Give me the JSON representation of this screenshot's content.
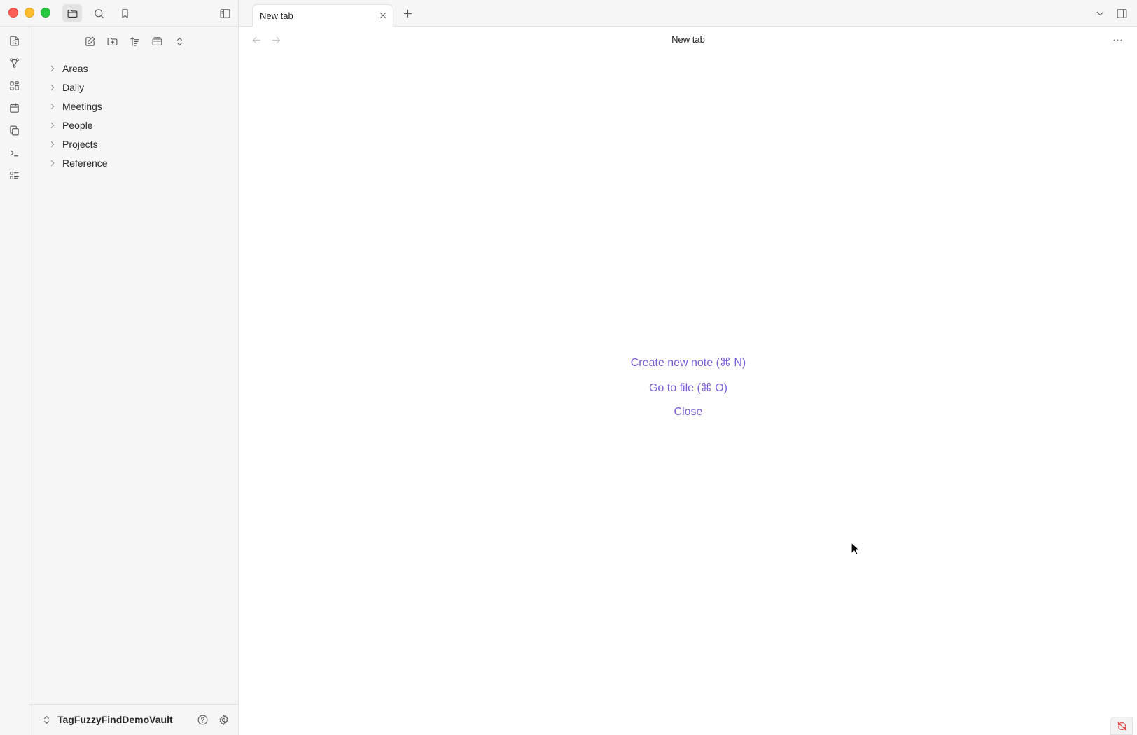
{
  "window": {
    "controls": [
      "close",
      "minimize",
      "zoom"
    ]
  },
  "left_header": {
    "tabs": [
      {
        "icon": "folder-icon",
        "label": "Files",
        "active": true
      },
      {
        "icon": "search-icon",
        "label": "Search"
      },
      {
        "icon": "bookmark-icon",
        "label": "Bookmarks"
      }
    ],
    "toggle_icon": "sidebar-left-icon"
  },
  "ribbon": {
    "items": [
      {
        "icon": "file-search-icon"
      },
      {
        "icon": "graph-icon"
      },
      {
        "icon": "canvas-icon"
      },
      {
        "icon": "calendar-icon"
      },
      {
        "icon": "copy-icon"
      },
      {
        "icon": "terminal-icon"
      },
      {
        "icon": "list-icon"
      }
    ]
  },
  "explorer": {
    "toolbar": [
      {
        "icon": "new-note-icon"
      },
      {
        "icon": "new-folder-icon"
      },
      {
        "icon": "sort-icon"
      },
      {
        "icon": "collapse-icon"
      },
      {
        "icon": "expand-collapse-icon"
      }
    ],
    "folders": [
      {
        "label": "Areas"
      },
      {
        "label": "Daily"
      },
      {
        "label": "Meetings"
      },
      {
        "label": "People"
      },
      {
        "label": "Projects"
      },
      {
        "label": "Reference"
      }
    ]
  },
  "vault": {
    "name": "TagFuzzyFindDemoVault"
  },
  "tabs": {
    "items": [
      {
        "title": "New tab",
        "active": true
      }
    ]
  },
  "view": {
    "title": "New tab"
  },
  "empty_state": {
    "create_note": "Create new note (⌘ N)",
    "go_to_file": "Go to file (⌘ O)",
    "close": "Close"
  },
  "colors": {
    "accent": "#7b5cd6",
    "sidebar_bg": "#f6f6f6",
    "sync_error": "#e04848"
  }
}
